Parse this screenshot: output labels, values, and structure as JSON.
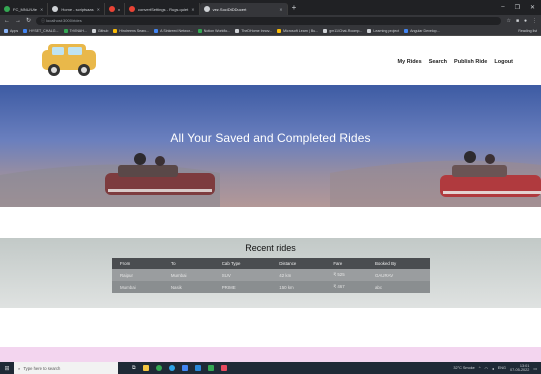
{
  "browser": {
    "tabs": [
      {
        "label": "FC_MNU/Ute",
        "color": "#34a853",
        "active": false
      },
      {
        "label": "Home - scriptsaas",
        "color": "#cfd2d6",
        "active": false
      },
      {
        "label": "x",
        "color": "#ea4335",
        "active": false
      },
      {
        "label": "convertSettings - Rugs.quiet",
        "color": "#ea4335",
        "active": false
      },
      {
        "label": "vez.SociDtDDucert",
        "color": "#cfd2d6",
        "active": true
      }
    ],
    "new_tab": "+",
    "address": "localhost:3000/rides",
    "bookmarks": [
      {
        "label": "Apps",
        "color": "#8ab4f8"
      },
      {
        "label": "HYSET_CHALG...",
        "color": "#4285f4"
      },
      {
        "label": "TrVINAH...",
        "color": "#34a853"
      },
      {
        "label": "Github",
        "color": "#cfd2d6"
      },
      {
        "label": "Hindreens Searc...",
        "color": "#fbbc05"
      },
      {
        "label": "A Sinkreed Networ...",
        "color": "#4285f4"
      },
      {
        "label": "Notion Workflo...",
        "color": "#34a853"
      },
      {
        "label": "TheDHome Innov...",
        "color": "#cfd2d6"
      },
      {
        "label": "Microsoft Learn | Bu...",
        "color": "#fbbc05"
      },
      {
        "label": "gm11/Chat-Roomp...",
        "color": "#cfd2d6"
      },
      {
        "label": "Learning project",
        "color": "#cfd2d6"
      },
      {
        "label": "Angular Develop...",
        "color": "#4285f4"
      }
    ],
    "reading_list": "Reading list"
  },
  "site": {
    "nav": [
      "My Rides",
      "Search",
      "Publish Ride",
      "Logout"
    ],
    "hero_title": "All Your Saved and Completed Rides",
    "rides_title": "Recent rides",
    "columns": [
      "From",
      "To",
      "Cab Type",
      "Distance",
      "Fare",
      "Booked By"
    ],
    "rows": [
      [
        "Raipur",
        "Mumbai",
        "SUV",
        "42 km",
        "₹ 525",
        "GAURAV"
      ],
      [
        "Mumbai",
        "Nasik",
        "PRIME",
        "150 km",
        "₹ 467",
        "abc"
      ]
    ]
  },
  "taskbar": {
    "search_placeholder": "Type here to search",
    "weather": "32°C Smoke",
    "lang": "ENG",
    "time": "13:01",
    "date": "07-05-2022"
  },
  "colors": {
    "hero_top": "#3d5ba3",
    "table_header": "#4a4d50",
    "pink_strip": "#f3d5ef",
    "logo_car": "#e9b84a"
  }
}
